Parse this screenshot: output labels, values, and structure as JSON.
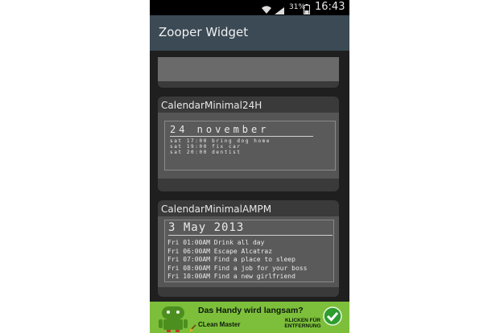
{
  "status_bar": {
    "battery_percent": "31%",
    "time": "16:43"
  },
  "app_bar": {
    "title": "Zooper Widget"
  },
  "widgets": [
    {
      "name": "CalendarMinimal24H",
      "date": "24 november",
      "events": [
        "sat 17:00 bring dog home",
        "sat 19:00 fix car",
        "sat 20:00 dentist"
      ]
    },
    {
      "name": "CalendarMinimalAMPM",
      "date": "3 May 2013",
      "events": [
        "Fri 01:00AM Drink all day",
        "Fri 06:00AM Escape Alcatraz",
        "Fri 07:00AM Find a place to sleep",
        "Fri 08:00AM Find a job for your boss",
        "Fri 10:00AM Find a new girlfriend"
      ]
    }
  ],
  "ad": {
    "headline": "Das Handy wird langsam?",
    "brand": "CLean Master",
    "cta_line1": "KLICKEN FÜR",
    "cta_line2": "ENTFERNUNG",
    "color": "#7dbf3a"
  },
  "icons": {
    "wifi": "wifi-icon",
    "signal": "signal-icon",
    "battery": "battery-icon",
    "robot": "android-robot-icon",
    "check": "checkmark-icon"
  }
}
